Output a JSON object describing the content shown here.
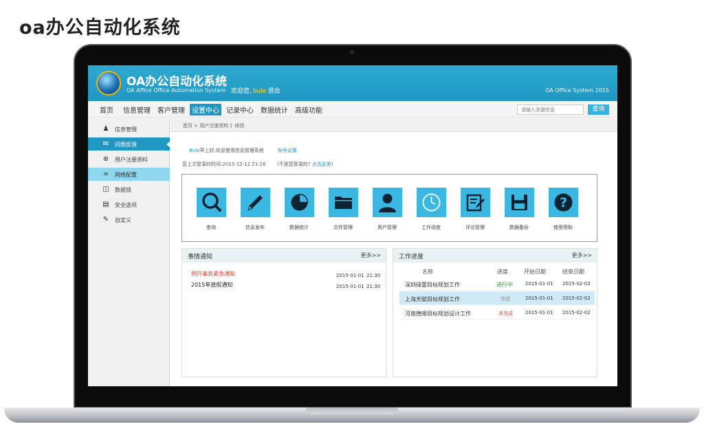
{
  "page_heading": "oa办公自动化系统",
  "app": {
    "title": "OA办公自动化系统",
    "subtitle": "OA Affice Office Automation System",
    "welcome_prefix": "欢迎您,",
    "username": "bule",
    "logout": "退出",
    "system_name": "OA Office System 2015"
  },
  "nav": {
    "items": [
      "首页",
      "信息管理",
      "客户管理",
      "设置中心",
      "记录中心",
      "数据统计",
      "高级功能"
    ],
    "active": "设置中心",
    "search_placeholder": "请输入关键信息",
    "search_button": "查询"
  },
  "sidebar": {
    "items": [
      {
        "label": "信息管理",
        "icon": "user-icon"
      },
      {
        "label": "问题反馈",
        "icon": "mail-icon"
      },
      {
        "label": "用户注册资料",
        "icon": "plus-circle-icon"
      },
      {
        "label": "网络配置",
        "icon": "network-icon"
      },
      {
        "label": "数据锁",
        "icon": "lock-icon"
      },
      {
        "label": "安全选项",
        "icon": "printer-icon"
      },
      {
        "label": "自定义",
        "icon": "pencil-icon"
      }
    ]
  },
  "breadcrumb": "首页 > 用户注册资料 》修改",
  "greeting": {
    "user": "Bule",
    "text": "早上好,欢迎使用信息管理系统",
    "account_link": "账号设置",
    "last_login": "您上次登录的时间:2015-12-12 21:16",
    "not_me_prefix": "(不是您登录的?",
    "not_me_link": "点击这里",
    "not_me_suffix": ")"
  },
  "tiles": [
    {
      "label": "查询",
      "icon": "search-icon"
    },
    {
      "label": "信息发布",
      "icon": "pencil-icon"
    },
    {
      "label": "数据统计",
      "icon": "pie-chart-icon"
    },
    {
      "label": "文件管理",
      "icon": "folder-icon"
    },
    {
      "label": "用户管理",
      "icon": "user-icon"
    },
    {
      "label": "工作进度",
      "icon": "clock-icon"
    },
    {
      "label": "评论管理",
      "icon": "edit-icon"
    },
    {
      "label": "数据备份",
      "icon": "save-icon"
    },
    {
      "label": "使用帮助",
      "icon": "help-icon"
    }
  ],
  "notices": {
    "title": "事情通知",
    "more": "更多>>",
    "items": [
      {
        "title": "例行事务紧急通知",
        "date": "2015-01-01",
        "time": "21:30",
        "urgent": true
      },
      {
        "title": "2015年放假通知",
        "date": "2015-01-01",
        "time": "21:30",
        "urgent": false
      }
    ]
  },
  "progress": {
    "title": "工作进度",
    "more": "更多>>",
    "headers": [
      "名称",
      "进度",
      "开始日期",
      "结束日期"
    ],
    "rows": [
      {
        "name": "深圳绿雷目标规划工作",
        "status": "进行中",
        "start": "2015-01-01",
        "end": "2015-02-02"
      },
      {
        "name": "上海天赋目标规划工作",
        "status": "完成",
        "start": "2015-01-01",
        "end": "2015-02-02"
      },
      {
        "name": "河南德顺目标规划设计工作",
        "status": "未完成",
        "start": "2015-01-01",
        "end": "2015-02-02"
      }
    ]
  },
  "colors": {
    "accent": "#1f97c2",
    "tile": "#3ab8e2",
    "urgent": "#e53a2e",
    "in_progress": "#2f9a3c",
    "done": "#888888",
    "not_done": "#e0504a"
  }
}
